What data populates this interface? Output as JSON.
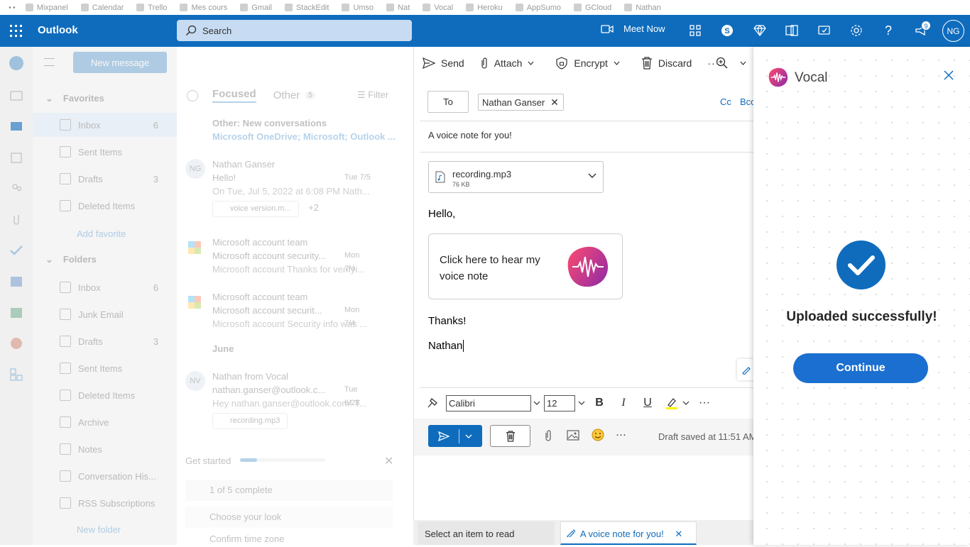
{
  "bookmarks": [
    "Mixpanel",
    "Calendar",
    "Trello",
    "Mes cours",
    "Gmail",
    "StackEdit",
    "Umso",
    "Nat",
    "Vocal",
    "Heroku",
    "AppSumo",
    "GCloud",
    "Nathan"
  ],
  "topbar": {
    "app_name": "Outlook",
    "search_placeholder": "Search",
    "meet_now": "Meet Now",
    "notification_count": "9",
    "avatar_initials": "NG",
    "brand_color": "#0f6cbd"
  },
  "nav": {
    "new_message": "New message",
    "favorites_header": "Favorites",
    "favorites": [
      {
        "label": "Inbox",
        "count": "6"
      },
      {
        "label": "Sent Items",
        "count": ""
      },
      {
        "label": "Drafts",
        "count": "3"
      },
      {
        "label": "Deleted Items",
        "count": ""
      }
    ],
    "add_favorite": "Add favorite",
    "folders_header": "Folders",
    "folders": [
      {
        "label": "Inbox",
        "count": "6"
      },
      {
        "label": "Junk Email",
        "count": ""
      },
      {
        "label": "Drafts",
        "count": "3"
      },
      {
        "label": "Sent Items",
        "count": ""
      },
      {
        "label": "Deleted Items",
        "count": ""
      },
      {
        "label": "Archive",
        "count": ""
      },
      {
        "label": "Notes",
        "count": ""
      },
      {
        "label": "Conversation His...",
        "count": ""
      },
      {
        "label": "RSS Subscriptions",
        "count": ""
      }
    ],
    "new_folder": "New folder"
  },
  "list": {
    "tab_focused": "Focused",
    "tab_other": "Other",
    "other_count": "5",
    "filter": "Filter",
    "other_title": "Other: New conversations",
    "other_senders": "Microsoft OneDrive; Microsoft; Outlook ...",
    "messages": [
      {
        "initials": "NG",
        "from": "Nathan Ganser",
        "subject": "Hello!",
        "date": "Tue 7/5",
        "preview": "On Tue, Jul 5, 2022 at 6:08 PM Nath...",
        "attachment": "voice version.m...",
        "more": "+2"
      },
      {
        "initials": "",
        "from": "Microsoft account team",
        "subject": "Microsoft account security...",
        "date": "Mon 7/4",
        "preview": "Microsoft account Thanks for verifyi..."
      },
      {
        "initials": "",
        "from": "Microsoft account team",
        "subject": "Microsoft account securit...",
        "date": "Mon 7/4",
        "preview": "Microsoft account Security info was ..."
      },
      {
        "initials": "NV",
        "from": "Nathan from Vocal",
        "subject": "nathan.ganser@outlook.c...",
        "date": "Tue 6/28",
        "preview": "Hey nathan.ganser@outlook.com! T...",
        "attachment": "recording.mp3"
      }
    ],
    "section_june": "June",
    "get_started": "Get started",
    "progress_fraction": 0.2,
    "complete": "1 of 5 complete",
    "choose_look": "Choose your look",
    "confirm_tz": "Confirm time zone"
  },
  "compose": {
    "toolbar": {
      "send": "Send",
      "attach": "Attach",
      "encrypt": "Encrypt",
      "discard": "Discard"
    },
    "to_label": "To",
    "recipient": "Nathan Ganser",
    "cc": "Cc",
    "bcc": "Bcc",
    "subject": "A voice note for you!",
    "attachment_name": "recording.mp3",
    "attachment_size": "76 KB",
    "greeting": "Hello,",
    "card_text": "Click here to hear my voice note",
    "thanks": "Thanks!",
    "signature": "Nathan",
    "font_name": "Calibri",
    "font_size": "12",
    "draft_status": "Draft saved at 11:51 AM"
  },
  "footer": {
    "tab1": "Select an item to read",
    "tab2": "A voice note for you!"
  },
  "vocal": {
    "title": "Vocal",
    "status": "Uploaded successfully!",
    "continue": "Continue"
  }
}
